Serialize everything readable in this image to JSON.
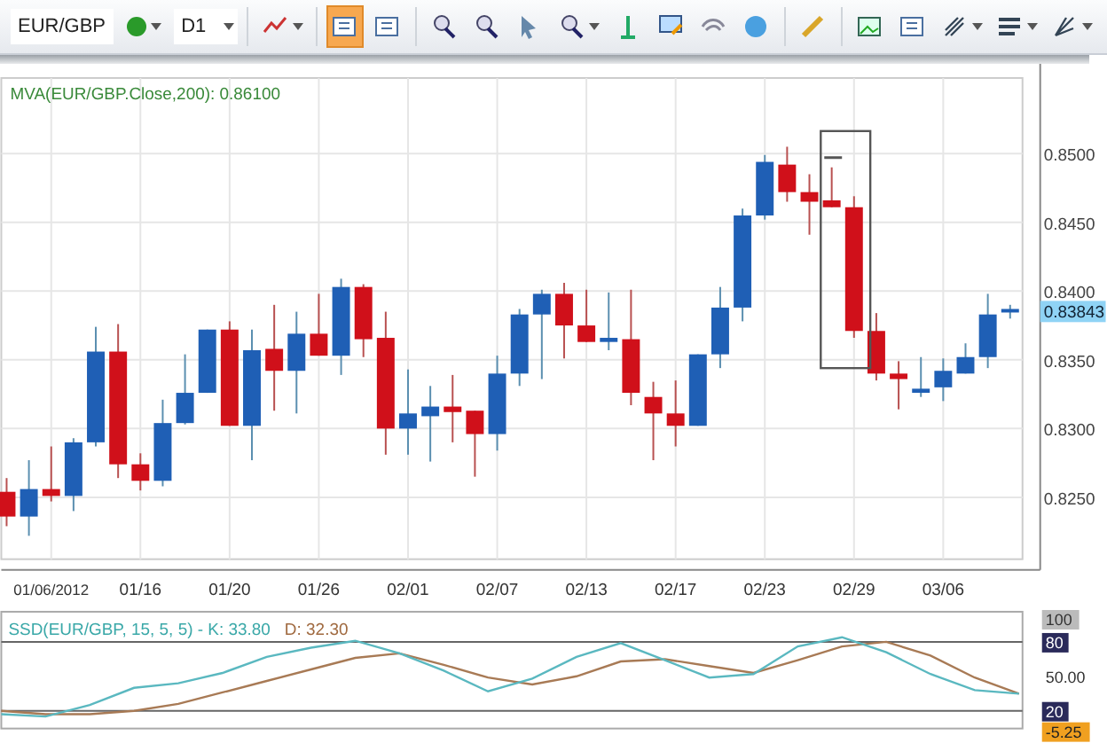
{
  "toolbar": {
    "symbol": "EUR/GBP",
    "timeframe": "D1",
    "tools": [
      {
        "selected": false
      },
      {
        "selected": true
      },
      {
        "selected": false
      },
      {
        "selected": false
      },
      {
        "selected": false
      },
      {
        "selected": false
      },
      {
        "selected": false
      },
      {
        "selected": false
      },
      {
        "selected": false
      },
      {
        "selected": false
      },
      {
        "selected": false
      },
      {
        "selected": false
      },
      {
        "selected": false
      },
      {
        "selected": false
      },
      {
        "selected": false
      },
      {
        "selected": false
      },
      {
        "selected": false
      }
    ]
  },
  "price_chart": {
    "indicator_label": "MVA(EUR/GBP.Close,200): 0.86100",
    "current_price": "0.83843",
    "chart_data": {
      "type": "candlestick",
      "categories": [
        null,
        null,
        "01/06/2012",
        null,
        null,
        null,
        "01/16",
        null,
        null,
        null,
        "01/20",
        null,
        null,
        null,
        "01/26",
        null,
        null,
        null,
        "02/01",
        null,
        null,
        null,
        "02/07",
        null,
        null,
        null,
        "02/13",
        null,
        null,
        null,
        "02/17",
        null,
        null,
        null,
        "02/23",
        null,
        null,
        null,
        "02/29",
        null,
        null,
        null,
        "03/06",
        null,
        null,
        null
      ],
      "ohlc": [
        [
          0.8254,
          0.8264,
          0.8229,
          0.8236
        ],
        [
          0.8236,
          0.8277,
          0.8222,
          0.8256
        ],
        [
          0.8256,
          0.8287,
          0.8247,
          0.8251
        ],
        [
          0.8251,
          0.8293,
          0.824,
          0.829
        ],
        [
          0.829,
          0.8374,
          0.8287,
          0.8356
        ],
        [
          0.8356,
          0.8376,
          0.8264,
          0.8274
        ],
        [
          0.8274,
          0.8282,
          0.8255,
          0.8262
        ],
        [
          0.8262,
          0.8321,
          0.8258,
          0.8304
        ],
        [
          0.8304,
          0.8354,
          0.8303,
          0.8326
        ],
        [
          0.8326,
          0.8372,
          0.8326,
          0.8372
        ],
        [
          0.8372,
          0.8378,
          0.8302,
          0.8302
        ],
        [
          0.8302,
          0.8372,
          0.8277,
          0.8357
        ],
        [
          0.8358,
          0.839,
          0.8313,
          0.8342
        ],
        [
          0.8342,
          0.8385,
          0.8311,
          0.8369
        ],
        [
          0.8369,
          0.8398,
          0.8353,
          0.8353
        ],
        [
          0.8353,
          0.8409,
          0.8339,
          0.8403
        ],
        [
          0.8403,
          0.8405,
          0.8352,
          0.8365
        ],
        [
          0.8366,
          0.8385,
          0.8281,
          0.83
        ],
        [
          0.83,
          0.8343,
          0.8281,
          0.8311
        ],
        [
          0.8309,
          0.8331,
          0.8276,
          0.8316
        ],
        [
          0.8316,
          0.8339,
          0.829,
          0.8312
        ],
        [
          0.8313,
          0.8313,
          0.8265,
          0.8296
        ],
        [
          0.8296,
          0.8353,
          0.8284,
          0.834
        ],
        [
          0.834,
          0.8387,
          0.8331,
          0.8383
        ],
        [
          0.8383,
          0.8401,
          0.8336,
          0.8398
        ],
        [
          0.8398,
          0.8406,
          0.8351,
          0.8375
        ],
        [
          0.8375,
          0.8401,
          0.8363,
          0.8363
        ],
        [
          0.8363,
          0.8399,
          0.8357,
          0.8366
        ],
        [
          0.8365,
          0.8401,
          0.8317,
          0.8326
        ],
        [
          0.8323,
          0.8334,
          0.8277,
          0.8311
        ],
        [
          0.8311,
          0.8335,
          0.8287,
          0.8302
        ],
        [
          0.8302,
          0.8354,
          0.8302,
          0.8354
        ],
        [
          0.8354,
          0.8403,
          0.8344,
          0.8388
        ],
        [
          0.8388,
          0.846,
          0.8378,
          0.8455
        ],
        [
          0.8455,
          0.8499,
          0.8452,
          0.8494
        ],
        [
          0.8492,
          0.8505,
          0.8465,
          0.8472
        ],
        [
          0.8472,
          0.8485,
          0.8441,
          0.8465
        ],
        [
          0.8466,
          0.849,
          0.8461,
          0.8461
        ],
        [
          0.8461,
          0.8469,
          0.8366,
          0.8371
        ],
        [
          0.8371,
          0.8384,
          0.8335,
          0.834
        ],
        [
          0.834,
          0.8349,
          0.8314,
          0.8336
        ],
        [
          0.8326,
          0.8352,
          0.8323,
          0.8329
        ],
        [
          0.833,
          0.8351,
          0.832,
          0.8342
        ],
        [
          0.834,
          0.8362,
          0.834,
          0.8352
        ],
        [
          0.8352,
          0.8398,
          0.8344,
          0.8383
        ],
        [
          0.8385,
          0.839,
          0.838,
          0.8387
        ]
      ],
      "grid": true,
      "ylim": [
        0.8205,
        0.8555
      ],
      "yticks": [
        {
          "value": 0.85,
          "label": "0.8500"
        },
        {
          "value": 0.845,
          "label": "0.8450"
        },
        {
          "value": 0.84,
          "label": "0.8400"
        },
        {
          "value": 0.835,
          "label": "0.8350"
        },
        {
          "value": 0.83,
          "label": "0.8300"
        },
        {
          "value": 0.825,
          "label": "0.8250"
        }
      ]
    }
  },
  "oscillator": {
    "name": "SSD(EUR/GBP, 15, 5, 5) -",
    "k_label": "K: 33.80",
    "d_label": "D: 32.30",
    "value_tag": "-5.25",
    "chart_data": {
      "type": "line",
      "ylim": [
        4.6,
        106.2
      ],
      "series": [
        {
          "color": "#5ab8c0",
          "values": [
            17,
            15,
            25,
            40,
            44,
            53,
            67,
            75,
            81,
            70,
            55,
            37,
            48,
            67,
            79,
            64,
            49,
            52,
            76,
            84,
            71,
            52,
            38,
            35
          ]
        },
        {
          "color": "#a87a55",
          "values": [
            20,
            17,
            17,
            20,
            26,
            36,
            46,
            56,
            66,
            70,
            60,
            49,
            43,
            50,
            63,
            65,
            59,
            53,
            64,
            76,
            80,
            68,
            49,
            35
          ]
        }
      ],
      "yticks": [
        {
          "value": 100,
          "label": "100"
        },
        {
          "value": 80,
          "label": "80"
        },
        {
          "value": 50,
          "label": "50.00"
        },
        {
          "value": 20,
          "label": "20"
        }
      ]
    }
  }
}
